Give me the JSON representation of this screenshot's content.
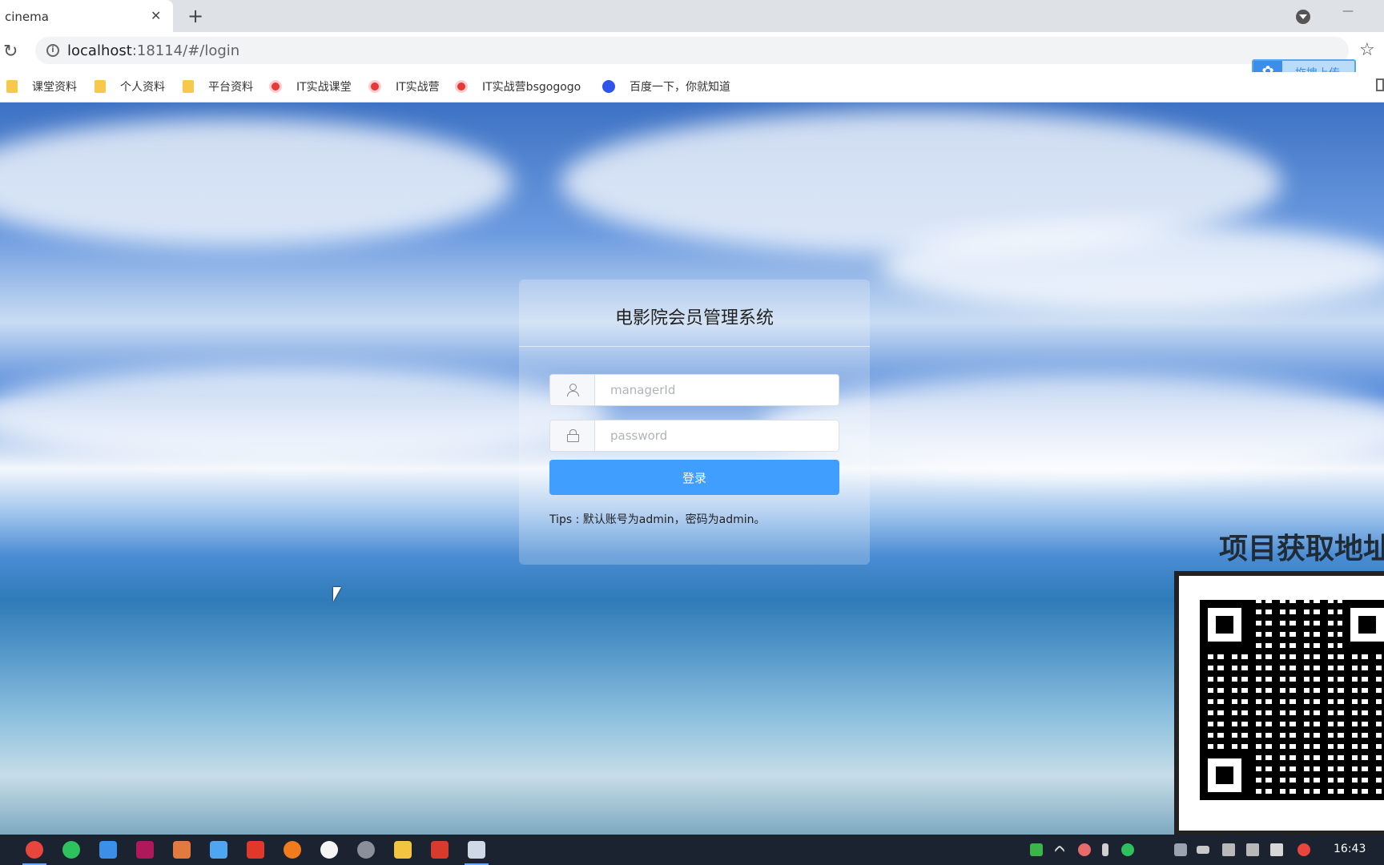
{
  "browser": {
    "tab_title": "cinema",
    "tab_close": "✕",
    "new_tab": "+",
    "url_host": "localhost",
    "url_rest": ":18114/#/login",
    "info_glyph": "i",
    "reload_glyph": "↻",
    "star_glyph": "☆",
    "minimize_glyph": "—",
    "upload_widget_label": "拖拽上传",
    "upload_widget_icon": "✿"
  },
  "bookmarks": [
    {
      "label": "课堂资料",
      "icon": "folder-icon"
    },
    {
      "label": "个人资料",
      "icon": "folder-icon"
    },
    {
      "label": "平台资料",
      "icon": "folder-icon"
    },
    {
      "label": "IT实战课堂",
      "icon": "chrome-icon"
    },
    {
      "label": "IT实战营",
      "icon": "chrome-icon"
    },
    {
      "label": "IT实战营bsgogogo",
      "icon": "chrome-icon"
    },
    {
      "label": "百度一下，你就知道",
      "icon": "baidu-icon"
    }
  ],
  "login": {
    "title": "电影院会员管理系统",
    "username_placeholder": "managerId",
    "password_placeholder": "password",
    "submit_label": "登录",
    "tips": "Tips : 默认账号为admin，密码为admin。"
  },
  "promo": {
    "title": "项目获取地址"
  },
  "taskbar": {
    "clock": "16:43"
  },
  "colors": {
    "primary": "#409eff",
    "taskbar": "#1c2330"
  }
}
